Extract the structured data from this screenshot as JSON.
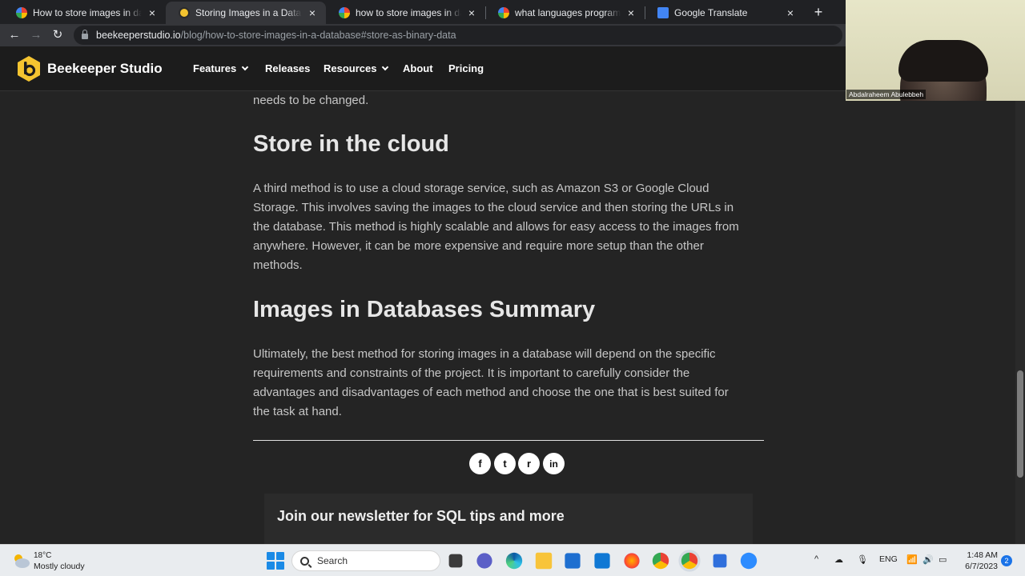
{
  "browser": {
    "tabs": [
      {
        "title": "How to store images in databas",
        "favicon": "google-icon",
        "active": false
      },
      {
        "title": "Storing Images in a Database: M",
        "favicon": "beekeeper-icon",
        "active": true
      },
      {
        "title": "how to store images in databas",
        "favicon": "google-icon",
        "active": false
      },
      {
        "title": "what languages programing can",
        "favicon": "google-icon",
        "active": false
      },
      {
        "title": "Google Translate",
        "favicon": "translate-icon",
        "active": false
      }
    ],
    "url_host": "beekeeperstudio.io",
    "url_path": "/blog/how-to-store-images-in-a-database#store-as-binary-data"
  },
  "site": {
    "brand": "Beekeeper Studio",
    "brand_color": "#f4c430",
    "nav": {
      "features": "Features",
      "releases": "Releases",
      "resources": "Resources",
      "about": "About",
      "pricing": "Pricing"
    }
  },
  "article": {
    "lead_fragment": "needs to be changed.",
    "cloud_heading": "Store in the cloud",
    "cloud_lines": [
      "A third method is to use a cloud storage service, such as Amazon S3 or Google Cloud",
      "Storage. This involves saving the images to the cloud service and then storing the URLs in",
      "the database. This method is highly scalable and allows for easy access to the images from",
      "anywhere. However, it can be more expensive and require more setup than the other",
      "methods."
    ],
    "summary_heading": "Images in Databases Summary",
    "summary_lines": [
      "Ultimately, the best method for storing images in a database will depend on the specific",
      "requirements and constraints of the project. It is important to carefully consider the",
      "advantages and disadvantages of each method and choose the one that is best suited for",
      "the task at hand."
    ],
    "share_icons": [
      "facebook-icon",
      "twitter-icon",
      "reddit-icon",
      "linkedin-icon"
    ],
    "share_glyphs": {
      "facebook": "f",
      "twitter": "t",
      "reddit": "r",
      "linkedin": "in"
    },
    "newsletter_title": "Join our newsletter for SQL tips and more"
  },
  "webcam": {
    "participant_name": "Abdalraheem Abulebbeh"
  },
  "taskbar": {
    "temperature": "18°C",
    "condition": "Mostly cloudy",
    "search_placeholder": "Search",
    "language": "ENG",
    "time": "1:48 AM",
    "date": "6/7/2023",
    "notification_count": "2"
  }
}
